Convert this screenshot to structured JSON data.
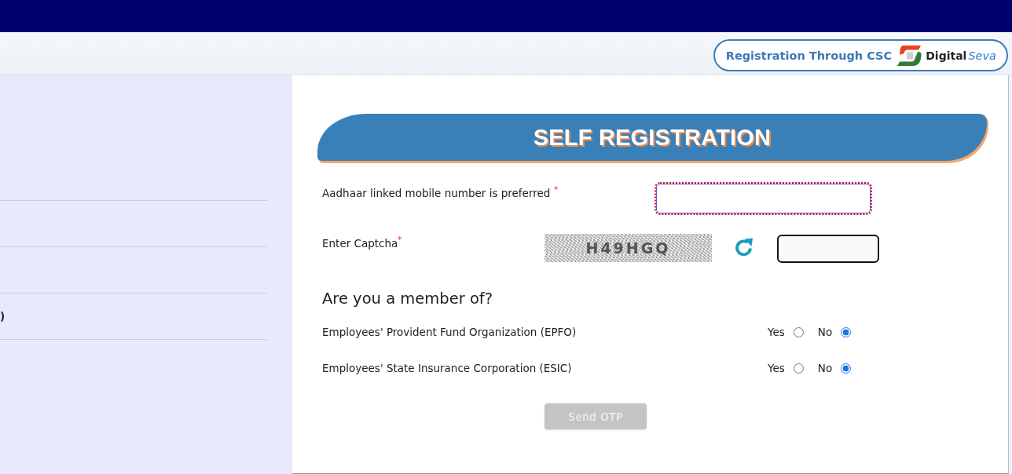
{
  "csc_button": {
    "label": "Registration Through CSC",
    "brand": "Digital",
    "brand_accent": "Seva"
  },
  "sidebar": {
    "items": [
      {
        "label": ")"
      }
    ]
  },
  "form": {
    "title": "SELF REGISTRATION",
    "fields": [
      {
        "kind": "text",
        "label": "Aadhaar linked mobile number is preferred",
        "required_mark": "*",
        "focused": true
      },
      {
        "kind": "captcha",
        "label": "Enter Captcha",
        "required_mark": "*",
        "captcha_text": "H49HGQ",
        "focused": false
      }
    ],
    "membership": {
      "heading": "Are you a member of?",
      "questions": [
        {
          "label": "Employees' Provident Fund Organization (EPFO)",
          "options": [
            {
              "label": "Yes",
              "selected": false
            },
            {
              "label": "No",
              "selected": true
            }
          ]
        },
        {
          "label": "Employees' State Insurance Corporation (ESIC)",
          "options": [
            {
              "label": "Yes",
              "selected": false
            },
            {
              "label": "No",
              "selected": true
            }
          ]
        }
      ]
    },
    "submit": {
      "label": "Send OTP",
      "disabled": true
    }
  }
}
